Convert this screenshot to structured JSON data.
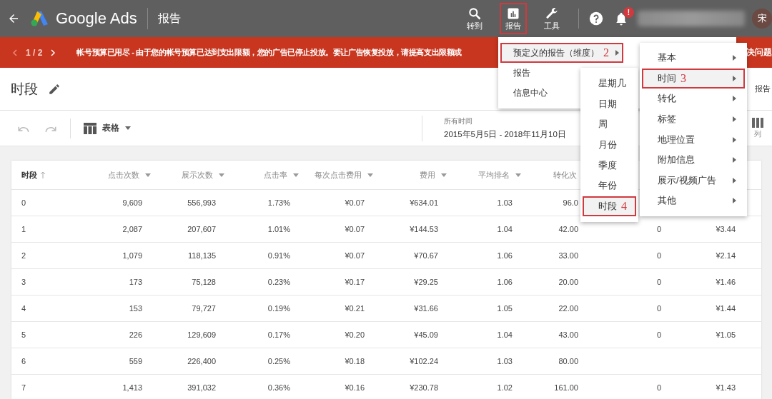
{
  "app_bar": {
    "logo_text": "Google Ads",
    "page_title": "报告",
    "nav": [
      {
        "kind": "search",
        "label": "转到",
        "highlighted": false
      },
      {
        "kind": "reports",
        "label": "报告",
        "highlighted": true
      },
      {
        "kind": "tools",
        "label": "工具",
        "highlighted": false
      }
    ],
    "notification_badge": "!",
    "avatar": "宋"
  },
  "alert_banner": {
    "pager": "1 / 2",
    "message": "帐号预算已用尽 - 由于您的帐号预算已达到支出限额，您的广告已停止投放。要让广告恢复投放，请提高支出限额或",
    "message_end": "决问题"
  },
  "page_heading": {
    "title": "时段",
    "side_text": "报告"
  },
  "toolbar": {
    "view": "表格",
    "date_label": "所有时间",
    "date_range": "2015年5月5日 - 2018年11月10日",
    "columns_button": "列"
  },
  "table": {
    "columns": [
      {
        "label": "时段",
        "kind": "sorted"
      },
      {
        "label": "点击次数",
        "kind": "dropdown"
      },
      {
        "label": "展示次数",
        "kind": "dropdown"
      },
      {
        "label": "点击率",
        "kind": "dropdown"
      },
      {
        "label": "每次点击费用",
        "kind": "dropdown"
      },
      {
        "label": "费用",
        "kind": "dropdown"
      },
      {
        "label": "平均排名",
        "kind": "dropdown"
      },
      {
        "label": "转化次",
        "kind": "plain"
      }
    ],
    "rows": [
      {
        "cells": [
          "0",
          "9,609",
          "556,993",
          "1.73%",
          "¥0.07",
          "¥634.01",
          "1.03",
          "96.0"
        ]
      },
      {
        "cells": [
          "1",
          "2,087",
          "207,607",
          "1.01%",
          "¥0.07",
          "¥144.53",
          "1.04",
          "42.00",
          "0",
          "¥3.44"
        ]
      },
      {
        "cells": [
          "2",
          "1,079",
          "118,135",
          "0.91%",
          "¥0.07",
          "¥70.67",
          "1.06",
          "33.00",
          "0",
          "¥2.14"
        ]
      },
      {
        "cells": [
          "3",
          "173",
          "75,128",
          "0.23%",
          "¥0.17",
          "¥29.25",
          "1.06",
          "20.00",
          "0",
          "¥1.46"
        ]
      },
      {
        "cells": [
          "4",
          "153",
          "79,727",
          "0.19%",
          "¥0.21",
          "¥31.66",
          "1.05",
          "22.00",
          "0",
          "¥1.44"
        ]
      },
      {
        "cells": [
          "5",
          "226",
          "129,609",
          "0.17%",
          "¥0.20",
          "¥45.09",
          "1.04",
          "43.00",
          "0",
          "¥1.05"
        ]
      },
      {
        "cells": [
          "6",
          "559",
          "226,400",
          "0.25%",
          "¥0.18",
          "¥102.24",
          "1.03",
          "80.00"
        ]
      },
      {
        "cells": [
          "7",
          "1,413",
          "391,032",
          "0.36%",
          "¥0.16",
          "¥230.78",
          "1.02",
          "161.00",
          "0",
          "¥1.43"
        ]
      }
    ]
  },
  "menus": [
    {
      "kind": "main",
      "items": [
        {
          "label": "预定义的报告（维度）",
          "highlighted": true,
          "annotation": "2",
          "submenu": true
        },
        {
          "label": "报告",
          "highlighted": false,
          "submenu": false
        },
        {
          "label": "信息中心",
          "highlighted": false,
          "submenu": false
        }
      ]
    },
    {
      "kind": "time",
      "items": [
        {
          "label": "星期几",
          "highlighted": false,
          "submenu": false
        },
        {
          "label": "日期",
          "highlighted": false,
          "submenu": false
        },
        {
          "label": "周",
          "highlighted": false,
          "submenu": false
        },
        {
          "label": "月份",
          "highlighted": false,
          "submenu": false
        },
        {
          "label": "季度",
          "highlighted": false,
          "submenu": false
        },
        {
          "label": "年份",
          "highlighted": false,
          "submenu": false
        },
        {
          "label": "时段",
          "highlighted": true,
          "annotation": "4",
          "submenu": false
        }
      ]
    },
    {
      "kind": "dimension",
      "items": [
        {
          "label": "基本",
          "highlighted": false,
          "submenu": true
        },
        {
          "label": "时间",
          "highlighted": true,
          "annotation": "3",
          "submenu": true
        },
        {
          "label": "转化",
          "highlighted": false,
          "submenu": true
        },
        {
          "label": "标签",
          "highlighted": false,
          "submenu": true
        },
        {
          "label": "地理位置",
          "highlighted": false,
          "submenu": true
        },
        {
          "label": "附加信息",
          "highlighted": false,
          "submenu": true
        },
        {
          "label": "展示/视频广告",
          "highlighted": false,
          "submenu": true
        },
        {
          "label": "其他",
          "highlighted": false,
          "submenu": true
        }
      ]
    }
  ]
}
